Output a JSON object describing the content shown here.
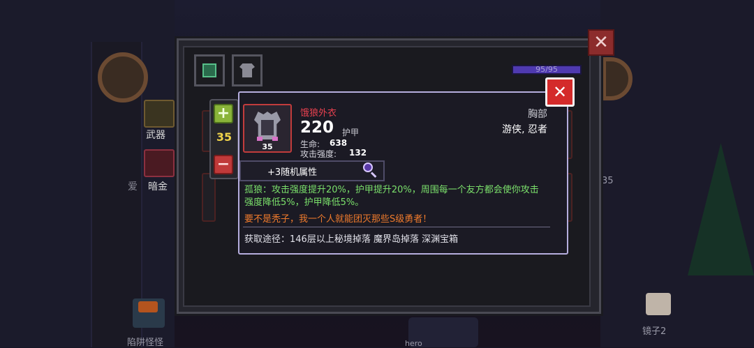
{
  "background": {
    "weapon_label": "武器",
    "bounty_label": "暗金",
    "love_label": "爱",
    "side_number": "35",
    "mirror_label": "镜子2",
    "trap_label": "陷阱怪怪",
    "hero_label": "hero"
  },
  "panel": {
    "tabs": [
      {
        "icon": "edit-icon"
      },
      {
        "icon": "shirt-icon"
      }
    ],
    "hp": {
      "text": "95/95",
      "fraction": 1.0
    }
  },
  "stepper": {
    "value": "35",
    "plus_icon": "plus-icon",
    "minus_icon": "minus-icon"
  },
  "tooltip": {
    "item_name": "饿狼外衣",
    "item_level": "35",
    "armor_value": "220",
    "armor_label": "护甲",
    "stats": [
      {
        "label": "生命:",
        "value": "638"
      },
      {
        "label": "攻击强度:",
        "value": "132"
      }
    ],
    "slot_type": "胸部",
    "classes": "游侠, 忍者",
    "random_attr": "+3随机属性",
    "effect": "孤狼：攻击强度提升20%，护甲提升20%，周围每一个友方都会使你攻击强度降低5%，护甲降低5%。",
    "flavor": "要不是秃子，我一个人就能团灭那些S级勇者！",
    "source": "获取途径：146层以上秘境掉落 魔界岛掉落 深渊宝箱"
  },
  "colors": {
    "item_name": "#e8414f",
    "effect": "#7be06b",
    "flavor": "#f07b2c",
    "level_text": "#f0d34a",
    "close_red": "#d42a2a"
  }
}
